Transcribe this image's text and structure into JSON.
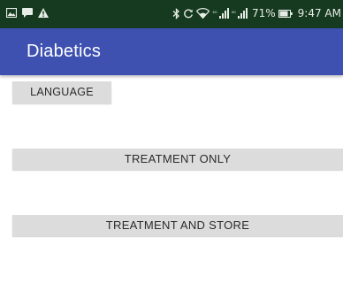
{
  "status_bar": {
    "left_icons": [
      "gallery-icon",
      "message-icon",
      "warning-icon"
    ],
    "right_icons": [
      "bluetooth-icon",
      "sync-icon",
      "wifi-icon",
      "signal-icon",
      "signal-icon",
      "battery-icon"
    ],
    "signal_labels": [
      "⁴ᴳ",
      "⁴ᴳ"
    ],
    "battery_percent": "71%",
    "time": "9:47 AM"
  },
  "app_bar": {
    "title": "Diabetics",
    "color": "#3e51b0"
  },
  "buttons": {
    "language": "LANGUAGE",
    "treatment_only": "TREATMENT ONLY",
    "treatment_and_store": "TREATMENT AND STORE"
  }
}
